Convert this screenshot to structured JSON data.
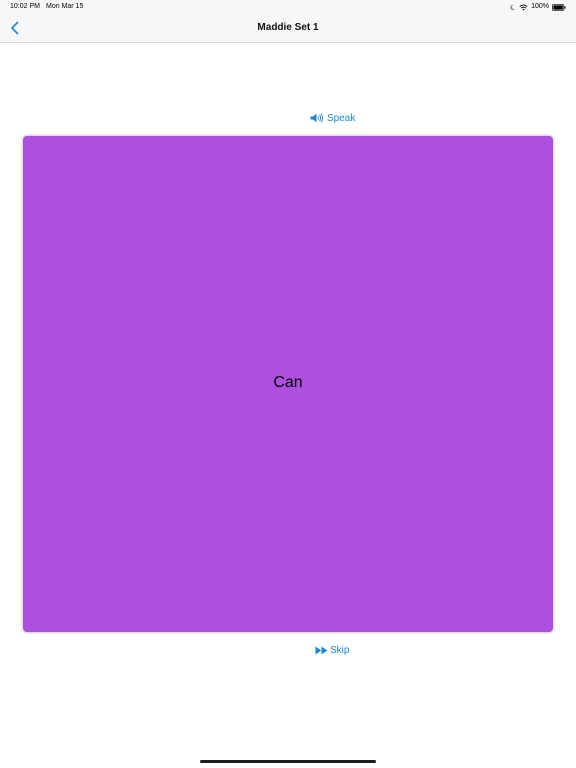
{
  "status_bar": {
    "time": "10:02 PM",
    "date": "Mon Mar 15",
    "battery": "100%"
  },
  "nav": {
    "title": "Maddie Set 1",
    "back_icon": "chevron-left-icon"
  },
  "speak": {
    "label": "Speak",
    "icon": "speaker-icon"
  },
  "card": {
    "word": "Can",
    "color": "#ad50e0"
  },
  "skip": {
    "label": "Skip",
    "icon": "fast-forward-icon"
  },
  "colors": {
    "accent": "#1a86d8",
    "bar_background": "#f7f7f7"
  }
}
